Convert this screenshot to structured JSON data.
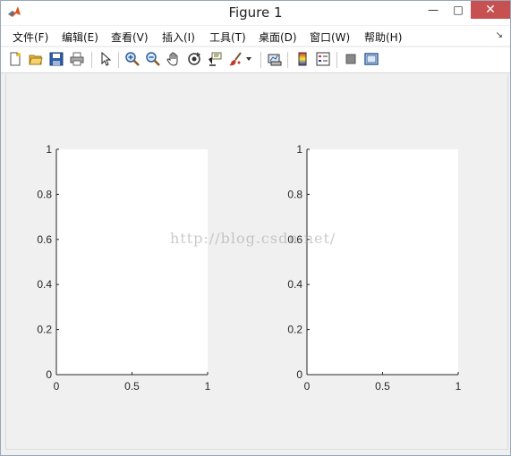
{
  "window": {
    "title": "Figure 1",
    "minimize_glyph": "—",
    "maximize_glyph": "□",
    "close_glyph": "✕"
  },
  "menu": {
    "items": [
      {
        "label": "文件(F)"
      },
      {
        "label": "编辑(E)"
      },
      {
        "label": "查看(V)"
      },
      {
        "label": "插入(I)"
      },
      {
        "label": "工具(T)"
      },
      {
        "label": "桌面(D)"
      },
      {
        "label": "窗口(W)"
      },
      {
        "label": "帮助(H)"
      }
    ],
    "overflow_glyph": "↘"
  },
  "toolbar": {
    "tools": [
      "new-figure-icon",
      "open-file-icon",
      "save-icon",
      "print-icon",
      "pointer-icon",
      "zoom-in-icon",
      "zoom-out-icon",
      "pan-hand-icon",
      "rotate-3d-icon",
      "data-cursor-icon",
      "brush-icon",
      "brush-dropdown-icon",
      "link-plot-icon",
      "colorbar-icon",
      "legend-icon",
      "hide-plot-tools-icon",
      "show-plot-tools-icon"
    ]
  },
  "watermark": "http://blog.csdn.net/",
  "chart_data": [
    {
      "type": "line",
      "x": [],
      "y": [],
      "xlim": [
        0,
        1
      ],
      "ylim": [
        0,
        1
      ],
      "xticks": [
        "0",
        "0.5",
        "1"
      ],
      "yticks": [
        "0",
        "0.2",
        "0.4",
        "0.6",
        "0.8",
        "1"
      ],
      "grid": false
    },
    {
      "type": "line",
      "x": [],
      "y": [],
      "xlim": [
        0,
        1
      ],
      "ylim": [
        0,
        1
      ],
      "xticks": [
        "0",
        "0.5",
        "1"
      ],
      "yticks": [
        "0",
        "0.2",
        "0.4",
        "0.6",
        "0.8",
        "1"
      ],
      "grid": false
    }
  ]
}
